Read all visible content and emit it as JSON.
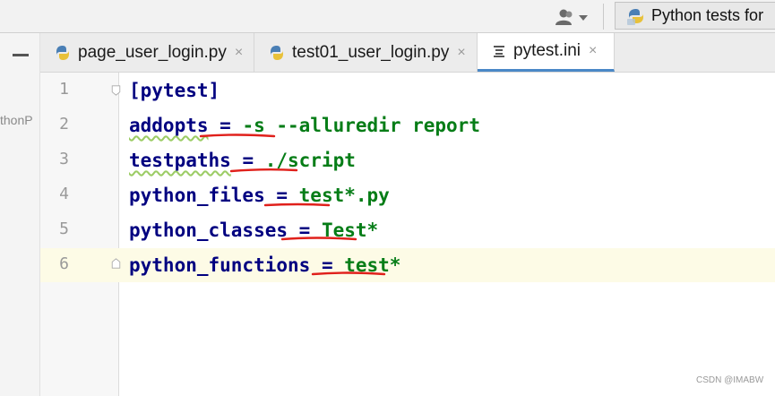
{
  "toolbar": {
    "run_config_label": "Python tests for"
  },
  "left_panel": {
    "project_fragment": "thonP"
  },
  "tabs": [
    {
      "label": "page_user_login.py",
      "icon": "python-file-icon",
      "active": false
    },
    {
      "label": "test01_user_login.py",
      "icon": "python-file-icon",
      "active": false
    },
    {
      "label": "pytest.ini",
      "icon": "ini-file-icon",
      "active": true
    }
  ],
  "tab_close_glyph": "×",
  "editor": {
    "line_numbers": [
      "1",
      "2",
      "3",
      "4",
      "5",
      "6"
    ],
    "lines": [
      {
        "key": "[pytest]",
        "eq": "",
        "value": ""
      },
      {
        "key": "addopts",
        "eq": " = ",
        "value": "-s --alluredir report"
      },
      {
        "key": "testpaths",
        "eq": " = ",
        "value": "./script"
      },
      {
        "key": "python_files",
        "eq": " = ",
        "value": "test*.py"
      },
      {
        "key": "python_classes",
        "eq": " = ",
        "value": "Test*"
      },
      {
        "key": "python_functions",
        "eq": " = ",
        "value": "test*"
      }
    ],
    "current_line": "6"
  },
  "colors": {
    "key": "#000080",
    "value": "#067d17",
    "annotation_underline": "#e0201b",
    "active_tab_accent": "#4a88c7",
    "current_line_bg": "#fdfbe6"
  },
  "watermark": "CSDN @IMABW"
}
